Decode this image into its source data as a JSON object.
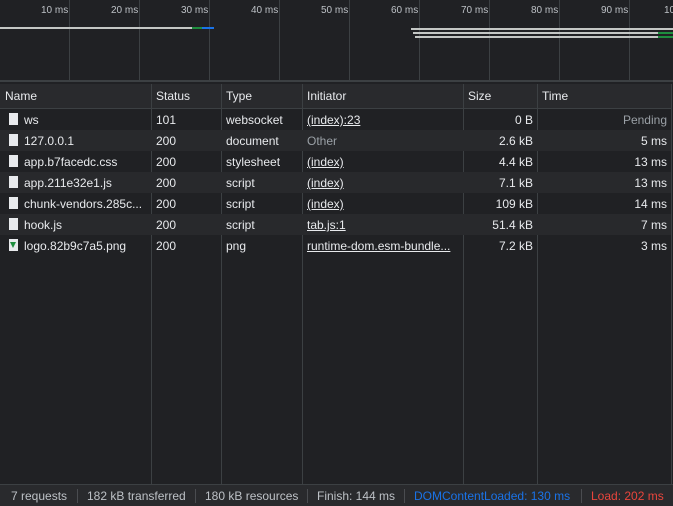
{
  "overview": {
    "ticks": [
      "10 ms",
      "20 ms",
      "30 ms",
      "40 ms",
      "50 ms",
      "60 ms",
      "70 ms",
      "80 ms",
      "90 ms",
      "10"
    ]
  },
  "table": {
    "headers": {
      "name": "Name",
      "status": "Status",
      "type": "Type",
      "initiator": "Initiator",
      "size": "Size",
      "time": "Time"
    },
    "rows": [
      {
        "name": "ws",
        "status": "101",
        "type": "websocket",
        "initiator": "(index):23",
        "size": "0 B",
        "time": "Pending",
        "icon": "document-icon"
      },
      {
        "name": "127.0.0.1",
        "status": "200",
        "type": "document",
        "initiator": "Other",
        "size": "2.6 kB",
        "time": "5 ms",
        "icon": "document-icon"
      },
      {
        "name": "app.b7facedc.css",
        "status": "200",
        "type": "stylesheet",
        "initiator": "(index)",
        "size": "4.4 kB",
        "time": "13 ms",
        "icon": "document-icon"
      },
      {
        "name": "app.211e32e1.js",
        "status": "200",
        "type": "script",
        "initiator": "(index)",
        "size": "7.1 kB",
        "time": "13 ms",
        "icon": "document-icon"
      },
      {
        "name": "chunk-vendors.285c...",
        "status": "200",
        "type": "script",
        "initiator": "(index)",
        "size": "109 kB",
        "time": "14 ms",
        "icon": "document-icon"
      },
      {
        "name": "hook.js",
        "status": "200",
        "type": "script",
        "initiator": "tab.js:1",
        "size": "51.4 kB",
        "time": "7 ms",
        "icon": "document-icon"
      },
      {
        "name": "logo.82b9c7a5.png",
        "status": "200",
        "type": "png",
        "initiator": "runtime-dom.esm-bundle...",
        "size": "7.2 kB",
        "time": "3 ms",
        "icon": "image-icon"
      }
    ]
  },
  "status_bar": {
    "requests": "7 requests",
    "transferred": "182 kB transferred",
    "resources": "180 kB resources",
    "finish": "Finish: 144 ms",
    "dom_content_loaded": "DOMContentLoaded: 130 ms",
    "load": "Load: 202 ms"
  },
  "colors": {
    "dom_content_loaded": "#1a73e8",
    "load": "#e8453c",
    "waterfall_green": "#1e8e3e",
    "waterfall_blue": "#1a73e8"
  }
}
